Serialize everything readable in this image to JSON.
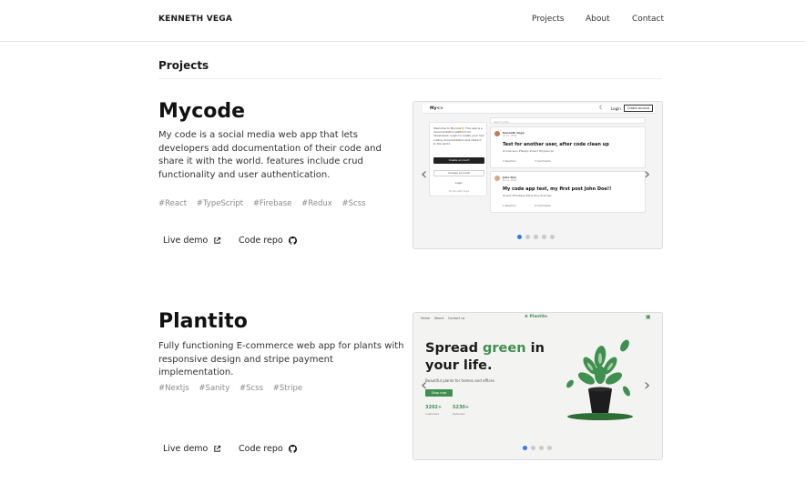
{
  "header": {
    "brand": "KENNETH VEGA",
    "nav": [
      "Projects",
      "About",
      "Contact"
    ]
  },
  "section": {
    "title": "Projects"
  },
  "projects": [
    {
      "title": "Mycode",
      "description": "My code is a social media web app that lets developers add documentation of their code and share it with the world. features include crud functionality and user authentication.",
      "tags": [
        "#React",
        "#TypeScript",
        "#Firebase",
        "#Redux",
        "#Scss"
      ],
      "live_label": "Live demo",
      "repo_label": "Code repo",
      "carousel": {
        "slides": 5,
        "active_slide": 1
      },
      "preview": {
        "logo": "My<>",
        "login": "Login",
        "create": "Create account",
        "welcome": "Welcome to Mycode👋 This app is a documentation platform for developers. Login to create your own coding documentation and share it to the world.",
        "btn_create": "Create account",
        "btn_google": "Google account",
        "btn_login": "Login",
        "note": "By Kenneth Vega",
        "search": "Search post",
        "post1_author": "Kenneth Vega",
        "post1_date": "Jul 10, 2022",
        "post1_title": "Test for another user, after code clean up",
        "post1_tags": "#codeclean  #Nextjs  #react  #typescript",
        "post1_likes": "1 Reaction",
        "post1_comments": "7 Comments",
        "post2_author": "John Doe",
        "post2_date": "Jul 10, 2022",
        "post2_title": "My code app test, my first post John Doe!!",
        "post2_tags": "#react  #Firebase  #first  #my-first-app",
        "post2_likes": "1 Reaction",
        "post2_comments": "0 Comments"
      }
    },
    {
      "title": "Plantito",
      "description": "Fully functioning E-commerce web app for plants with responsive design and stripe payment implementation.",
      "tags": [
        "#Nextjs",
        "#Sanity",
        "#Scss",
        "#Stripe"
      ],
      "live_label": "Live demo",
      "repo_label": "Code repo",
      "carousel": {
        "slides": 4,
        "active_slide": 1
      },
      "preview": {
        "nav": [
          "Home",
          "About",
          "Contact us"
        ],
        "logo": "Plantito",
        "hero_line1": "Spread ",
        "hero_green": "green",
        "hero_line1b": " in",
        "hero_line2": "your life.",
        "subtitle": "Beautiful plants for homes and offices",
        "cta": "Shop now",
        "stat1_value": "3202+",
        "stat1_label": "Customers",
        "stat2_value": "5230+",
        "stat2_label": "Delivered"
      }
    }
  ],
  "colors": {
    "accent_blue": "#2b7de9",
    "plant_green": "#3f8f4f",
    "text_dark": "#111111",
    "tag_gray": "#8a8a8a"
  },
  "icons": {
    "external_link": "external-link-icon",
    "github": "github-icon",
    "prev": "chevron-left-icon",
    "next": "chevron-right-icon"
  }
}
